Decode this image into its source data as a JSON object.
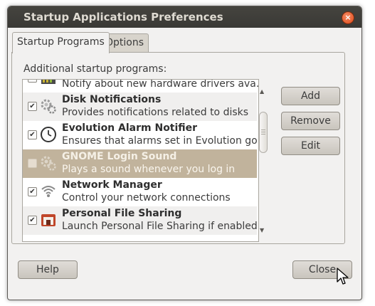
{
  "window": {
    "title": "Startup Applications Preferences",
    "close_glyph": "×"
  },
  "tabs": [
    {
      "label": "Startup Programs",
      "active": true
    },
    {
      "label": "Options",
      "active": false
    }
  ],
  "section_label": "Additional startup programs:",
  "programs": [
    {
      "name": "",
      "description": "Notify about new hardware drivers ava...",
      "checked": true,
      "icon": "hardware-driver-icon"
    },
    {
      "name": "Disk Notifications",
      "description": "Provides notifications related to disks",
      "checked": true,
      "icon": "gears-icon"
    },
    {
      "name": "Evolution Alarm Notifier",
      "description": "Ensures that alarms set in Evolution go...",
      "checked": true,
      "icon": "clock-icon"
    },
    {
      "name": "GNOME Login Sound",
      "description": "Plays a sound whenever you log in",
      "checked": false,
      "selected": true,
      "icon": "gears-icon"
    },
    {
      "name": "Network Manager",
      "description": "Control your network connections",
      "checked": true,
      "icon": "wireless-icon"
    },
    {
      "name": "Personal File Sharing",
      "description": "Launch Personal File Sharing if enabled",
      "checked": true,
      "icon": "file-sharing-icon"
    }
  ],
  "buttons": {
    "add": "Add",
    "remove": "Remove",
    "edit": "Edit",
    "help": "Help",
    "close": "Close"
  },
  "colors": {
    "titlebar": "#3c3b37",
    "selection": "#c1b39c",
    "close_button": "#df4b1a"
  }
}
